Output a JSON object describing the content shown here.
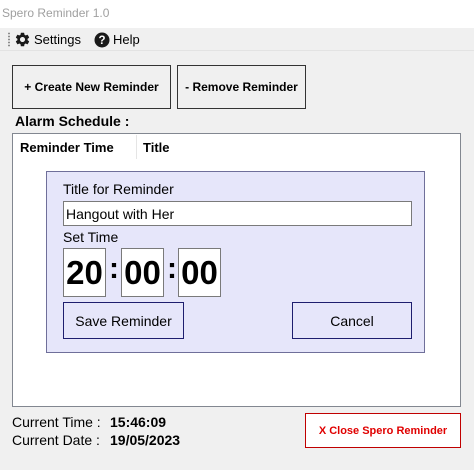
{
  "window": {
    "title": "Spero Reminder 1.0"
  },
  "menu": {
    "settings": {
      "label": "Settings",
      "icon": "gear-icon"
    },
    "help": {
      "label": "Help",
      "icon": "help-circle-icon"
    }
  },
  "toolbar": {
    "create_label": "+ Create New Reminder",
    "remove_label": "- Remove Reminder"
  },
  "schedule": {
    "label": "Alarm Schedule :",
    "columns": [
      "Reminder Time",
      "Title"
    ]
  },
  "dialog": {
    "title_label": "Title for Reminder",
    "title_value": "Hangout with Her",
    "time_label": "Set Time",
    "hours": "20",
    "minutes": "00",
    "seconds": "00",
    "separator": ":",
    "save_label": "Save Reminder",
    "cancel_label": "Cancel"
  },
  "status": {
    "time_label": "Current Time :",
    "time_value": "15:46:09",
    "date_label": "Current Date :",
    "date_value": "19/05/2023"
  },
  "close_label": "X Close Spero Reminder",
  "colors": {
    "dialog_bg": "#e6e6fa",
    "close_text": "#e00000",
    "close_border": "#c00000",
    "help_icon": "#1a1a1a"
  }
}
